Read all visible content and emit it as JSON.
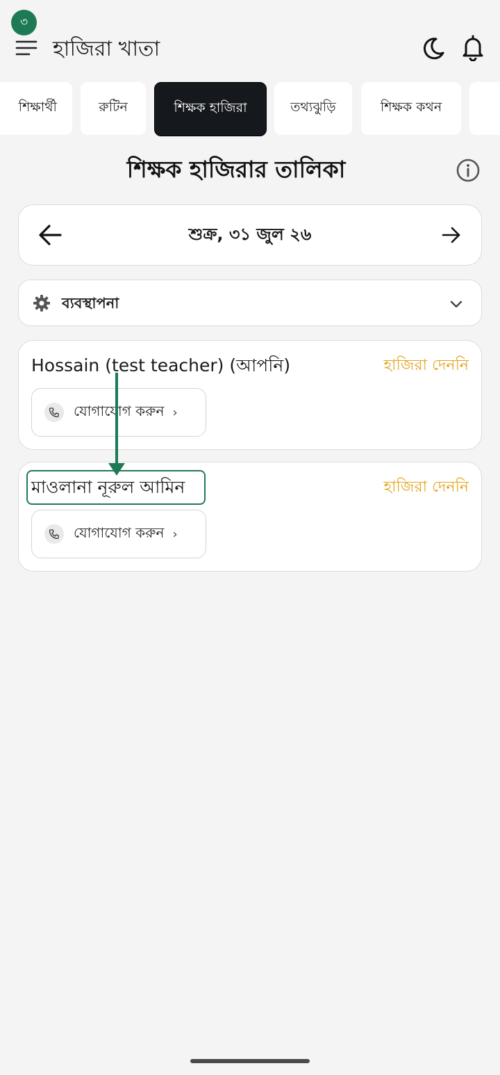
{
  "header": {
    "badge_count": "৩",
    "app_title": "হাজিরা খাতা"
  },
  "tabs": [
    {
      "label": "শিক্ষার্থী",
      "active": false
    },
    {
      "label": "রুটিন",
      "active": false
    },
    {
      "label": "শিক্ষক হাজিরা",
      "active": true
    },
    {
      "label": "তথ্যঝুড়ি",
      "active": false
    },
    {
      "label": "শিক্ষক কথন",
      "active": false
    },
    {
      "label": "",
      "active": false
    }
  ],
  "section_title": "শিক্ষক হাজিরার তালিকা",
  "date_nav": {
    "date_text": "শুক্র, ৩১ জুল ২৬"
  },
  "management": {
    "label": "ব্যবস্থাপনা"
  },
  "teachers": [
    {
      "name": "Hossain (test teacher) (আপনি)",
      "status": "হাজিরা দেননি",
      "contact_label": "যোগাযোগ করুন",
      "chevron": "›"
    },
    {
      "name": "মাওলানা নূরুল আমিন",
      "status": "হাজিরা দেননি",
      "contact_label": "যোগাযোগ করুন",
      "chevron": "›"
    }
  ],
  "colors": {
    "accent_green": "#1e7a55",
    "status_amber": "#e3a41f",
    "active_tab": "#15181d"
  }
}
